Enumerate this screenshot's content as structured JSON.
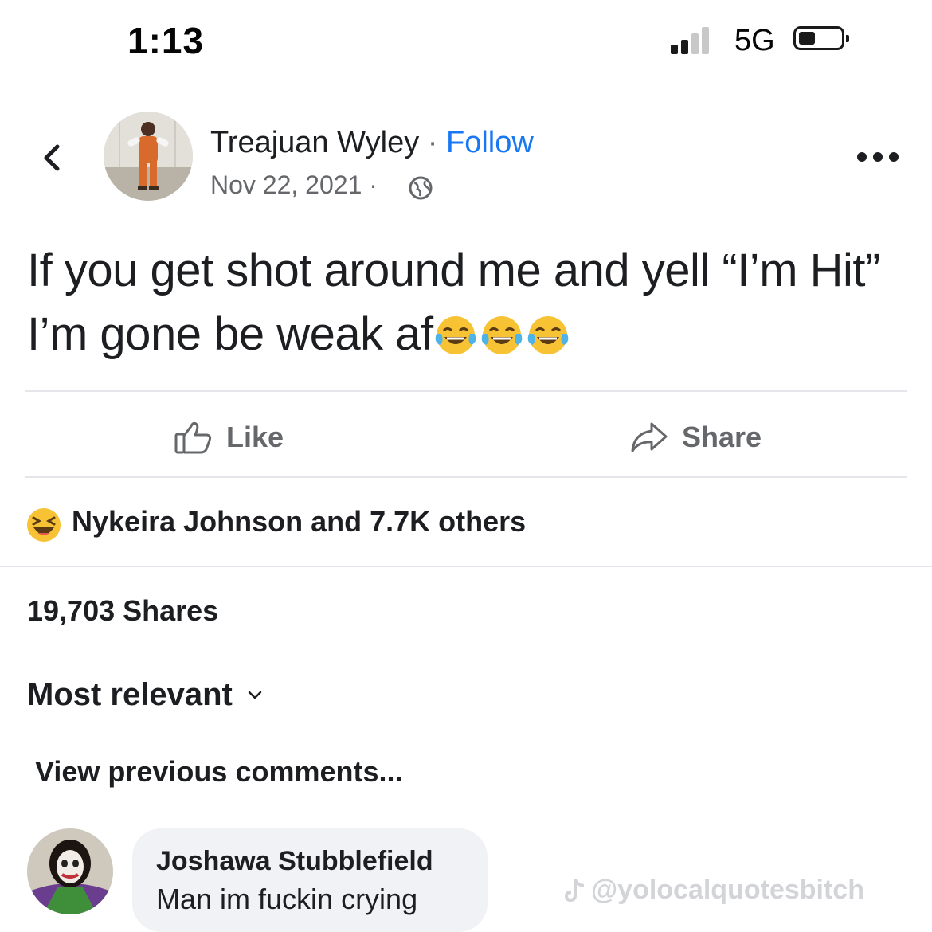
{
  "status_bar": {
    "time": "1:13",
    "network": "5G"
  },
  "post": {
    "author": "Treajuan Wyley",
    "separator": " · ",
    "follow_label": "Follow",
    "date": "Nov 22, 2021 ·",
    "text_before_emoji": "If you get shot around me and yell “I’m Hit” I’m gone be weak af",
    "emoji": [
      "tears-of-joy-emoji",
      "tears-of-joy-emoji",
      "tears-of-joy-emoji"
    ]
  },
  "actions": {
    "like_label": "Like",
    "share_label": "Share"
  },
  "engagement": {
    "reactions_text": "Nykeira Johnson and 7.7K others",
    "shares_text": "19,703 Shares"
  },
  "comments": {
    "sort_label": "Most relevant",
    "view_previous": "View previous comments...",
    "items": [
      {
        "name": "Joshawa Stubblefield",
        "text": "Man im fuckin crying"
      }
    ]
  },
  "watermark": "@yolocalquotesbitch",
  "colors": {
    "link": "#1877f2",
    "muted": "#65676b",
    "divider": "#e4e6eb",
    "bubble": "#f0f2f5"
  }
}
